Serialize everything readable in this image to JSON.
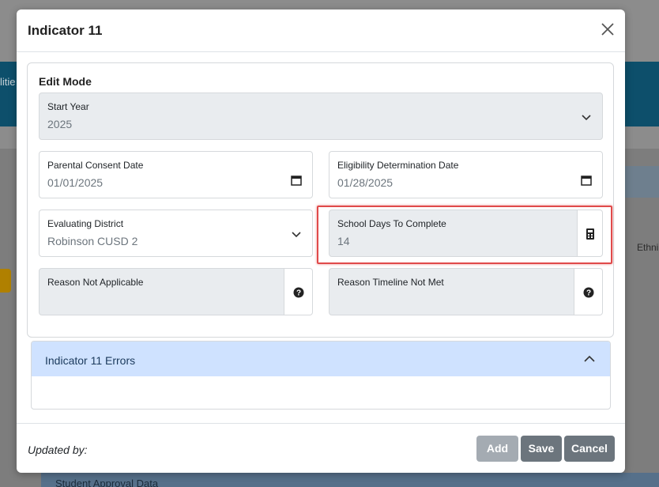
{
  "background": {
    "bar_text": "litie",
    "right_text": "Ethni",
    "bottom_text": "Student Approval Data"
  },
  "modal": {
    "title": "Indicator 11",
    "edit_mode_label": "Edit Mode",
    "start_year": {
      "label": "Start Year",
      "value": "2025"
    },
    "parental_consent": {
      "label": "Parental Consent Date",
      "value": "01/01/2025"
    },
    "eligibility": {
      "label": "Eligibility Determination Date",
      "value": "01/28/2025"
    },
    "evaluating_district": {
      "label": "Evaluating District",
      "value": "Robinson CUSD 2"
    },
    "school_days": {
      "label": "School Days To Complete",
      "value": "14"
    },
    "reason_not_applicable": {
      "label": "Reason Not Applicable"
    },
    "reason_timeline": {
      "label": "Reason Timeline Not Met"
    },
    "errors_title": "Indicator 11 Errors",
    "updated_by": "Updated by:",
    "buttons": {
      "add": "Add",
      "save": "Save",
      "cancel": "Cancel"
    }
  },
  "colors": {
    "highlight": "#e04a4a",
    "errors_header": "#cfe2ff",
    "button": "#6c757d",
    "button_disabled": "#a4abb2"
  }
}
